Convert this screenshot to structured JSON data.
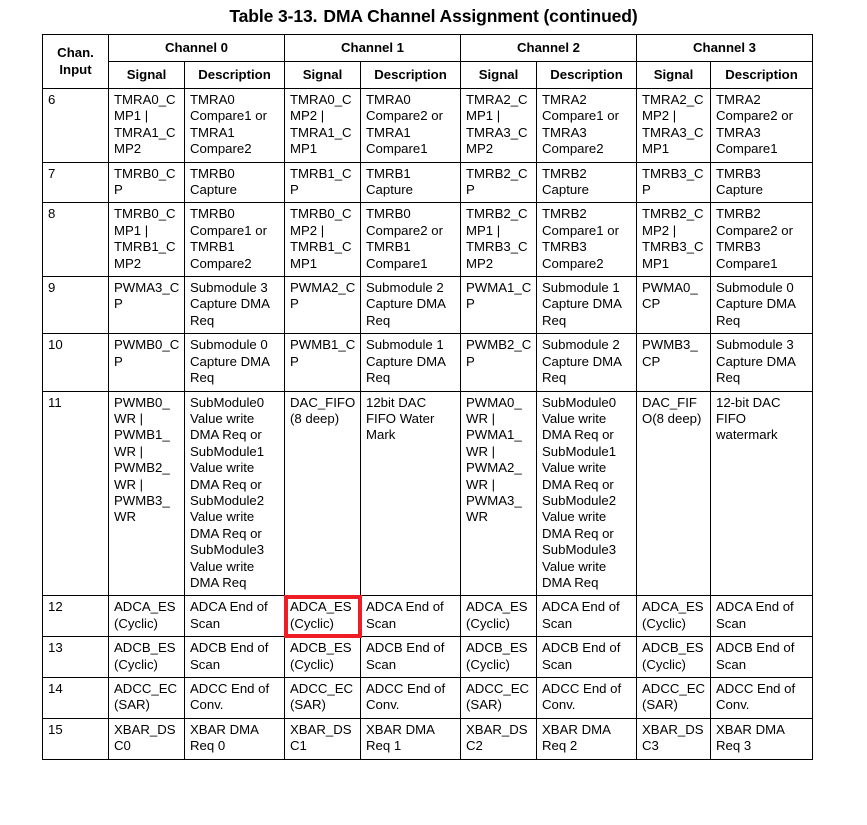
{
  "caption": {
    "number": "Table 3-13.",
    "text": "DMA Channel Assignment (continued)"
  },
  "table": {
    "header": {
      "chan_input": "Chan.\nInput",
      "chan_input_line1": "Chan.",
      "chan_input_line2": "Input",
      "channels": [
        "Channel 0",
        "Channel 1",
        "Channel 2",
        "Channel 3"
      ],
      "sub": [
        "Signal",
        "Description"
      ]
    },
    "rows": [
      {
        "input": "6",
        "cells": [
          "TMRA0_CMP1 | TMRA1_CMP2",
          "TMRA0 Compare1 or TMRA1 Compare2",
          "TMRA0_CMP2 | TMRA1_CMP1",
          "TMRA0 Compare2 or TMRA1 Compare1",
          "TMRA2_CMP1 | TMRA3_CMP2",
          "TMRA2 Compare1 or TMRA3 Compare2",
          "TMRA2_CMP2 | TMRA3_CMP1",
          "TMRA2 Compare2 or TMRA3 Compare1"
        ]
      },
      {
        "input": "7",
        "cells": [
          "TMRB0_CP",
          "TMRB0 Capture",
          "TMRB1_CP",
          "TMRB1 Capture",
          "TMRB2_CP",
          "TMRB2 Capture",
          "TMRB3_CP",
          "TMRB3 Capture"
        ]
      },
      {
        "input": "8",
        "cells": [
          "TMRB0_CMP1 | TMRB1_CMP2",
          "TMRB0 Compare1 or TMRB1 Compare2",
          "TMRB0_CMP2 | TMRB1_CMP1",
          "TMRB0 Compare2 or TMRB1 Compare1",
          "TMRB2_CMP1 | TMRB3_CMP2",
          "TMRB2 Compare1 or TMRB3 Compare2",
          "TMRB2_CMP2 | TMRB3_CMP1",
          "TMRB2 Compare2 or TMRB3 Compare1"
        ]
      },
      {
        "input": "9",
        "cells": [
          "PWMA3_CP",
          "Submodule 3 Capture DMA Req",
          "PWMA2_CP",
          "Submodule 2 Capture DMA Req",
          "PWMA1_CP",
          "Submodule 1 Capture DMA Req",
          "PWMA0_CP",
          "Submodule 0 Capture DMA Req"
        ]
      },
      {
        "input": "10",
        "cells": [
          "PWMB0_CP",
          "Submodule 0 Capture DMA Req",
          "PWMB1_CP",
          "Submodule 1 Capture DMA Req",
          "PWMB2_CP",
          "Submodule 2 Capture DMA Req",
          "PWMB3_CP",
          "Submodule 3 Capture DMA Req"
        ]
      },
      {
        "input": "11",
        "cells": [
          "PWMB0_WR | PWMB1_WR | PWMB2_WR | PWMB3_WR",
          "SubModule0 Value write DMA Req or SubModule1 Value write DMA Req or SubModule2 Value write DMA Req or SubModule3 Value write DMA Req",
          "DAC_FIFO (8 deep)",
          "12bit DAC FIFO Water Mark",
          "PWMA0_WR | PWMA1_WR | PWMA2_WR | PWMA3_WR",
          "SubModule0 Value write DMA Req or SubModule1 Value write DMA Req or SubModule2 Value write DMA Req or SubModule3 Value write DMA Req",
          "DAC_FIFO(8 deep)",
          "12-bit DAC FIFO watermark"
        ]
      },
      {
        "input": "12",
        "cells": [
          "ADCA_ES (Cyclic)",
          "ADCA End of Scan",
          "ADCA_ES (Cyclic)",
          "ADCA End of Scan",
          "ADCA_ES (Cyclic)",
          "ADCA End of Scan",
          "ADCA_ES (Cyclic)",
          "ADCA End of Scan"
        ]
      },
      {
        "input": "13",
        "cells": [
          "ADCB_ES (Cyclic)",
          "ADCB End of Scan",
          "ADCB_ES (Cyclic)",
          "ADCB End of Scan",
          "ADCB_ES (Cyclic)",
          "ADCB End of Scan",
          "ADCB_ES (Cyclic)",
          "ADCB End of Scan"
        ]
      },
      {
        "input": "14",
        "cells": [
          "ADCC_EC (SAR)",
          "ADCC End of Conv.",
          "ADCC_EC (SAR)",
          "ADCC End of Conv.",
          "ADCC_EC (SAR)",
          "ADCC End of Conv.",
          "ADCC_EC (SAR)",
          "ADCC End of Conv."
        ]
      },
      {
        "input": "15",
        "cells": [
          "XBAR_DSC0",
          "XBAR DMA Req 0",
          "XBAR_DSC1",
          "XBAR DMA Req 1",
          "XBAR_DSC2",
          "XBAR DMA Req 2",
          "XBAR_DSC3",
          "XBAR DMA Req 3"
        ]
      }
    ]
  },
  "annotation": {
    "highlight_color": "#ee1c24",
    "target_row_input": "12",
    "target_column": "Channel 1 Signal",
    "target_text": "ADCA_ES (Cyclic)"
  }
}
